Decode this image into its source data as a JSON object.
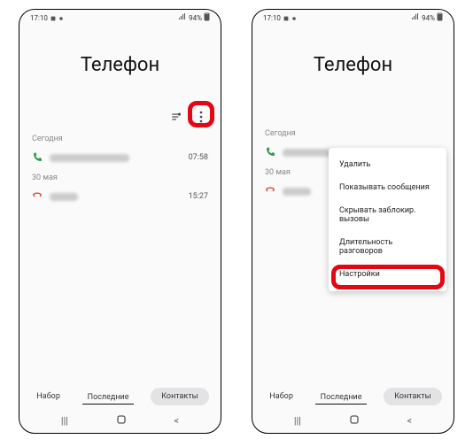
{
  "status": {
    "time": "17:10",
    "battery_text": "94%"
  },
  "title": "Телефон",
  "sections": {
    "today_label": "Сегодня",
    "may30_label": "30 мая",
    "entry1_time": "07:58",
    "entry2_time": "15:27"
  },
  "menu": {
    "delete": "Удалить",
    "show_msg": "Показывать сообщения",
    "hide_blocked": "Скрывать заблокир. вызовы",
    "call_duration": "Длительность разговоров",
    "settings": "Настройки"
  },
  "nav": {
    "keypad": "Набор",
    "recents": "Последние",
    "contacts": "Контакты"
  }
}
